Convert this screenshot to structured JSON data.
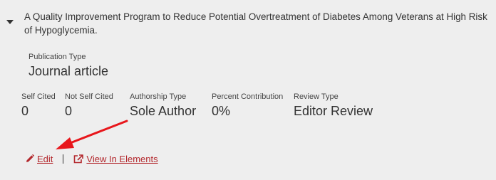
{
  "record": {
    "title": "A Quality Improvement Program to Reduce Potential Overtreatment of Diabetes Among Veterans at High Risk of Hypoglycemia.",
    "publication_type": {
      "label": "Publication Type",
      "value": "Journal article"
    },
    "metrics": [
      {
        "label": "Self Cited",
        "value": "0"
      },
      {
        "label": "Not Self Cited",
        "value": "0"
      },
      {
        "label": "Authorship Type",
        "value": "Sole Author"
      },
      {
        "label": "Percent Contribution",
        "value": "0%"
      },
      {
        "label": "Review Type",
        "value": "Editor Review"
      }
    ]
  },
  "actions": {
    "edit_label": "Edit",
    "view_label": "View In Elements"
  },
  "icons": {
    "toggle": "caret-down-icon",
    "edit": "pencil-icon",
    "view": "external-link-icon"
  },
  "colors": {
    "background": "#eeeeee",
    "link": "#b3282d",
    "annotation_arrow": "#e8161b"
  }
}
